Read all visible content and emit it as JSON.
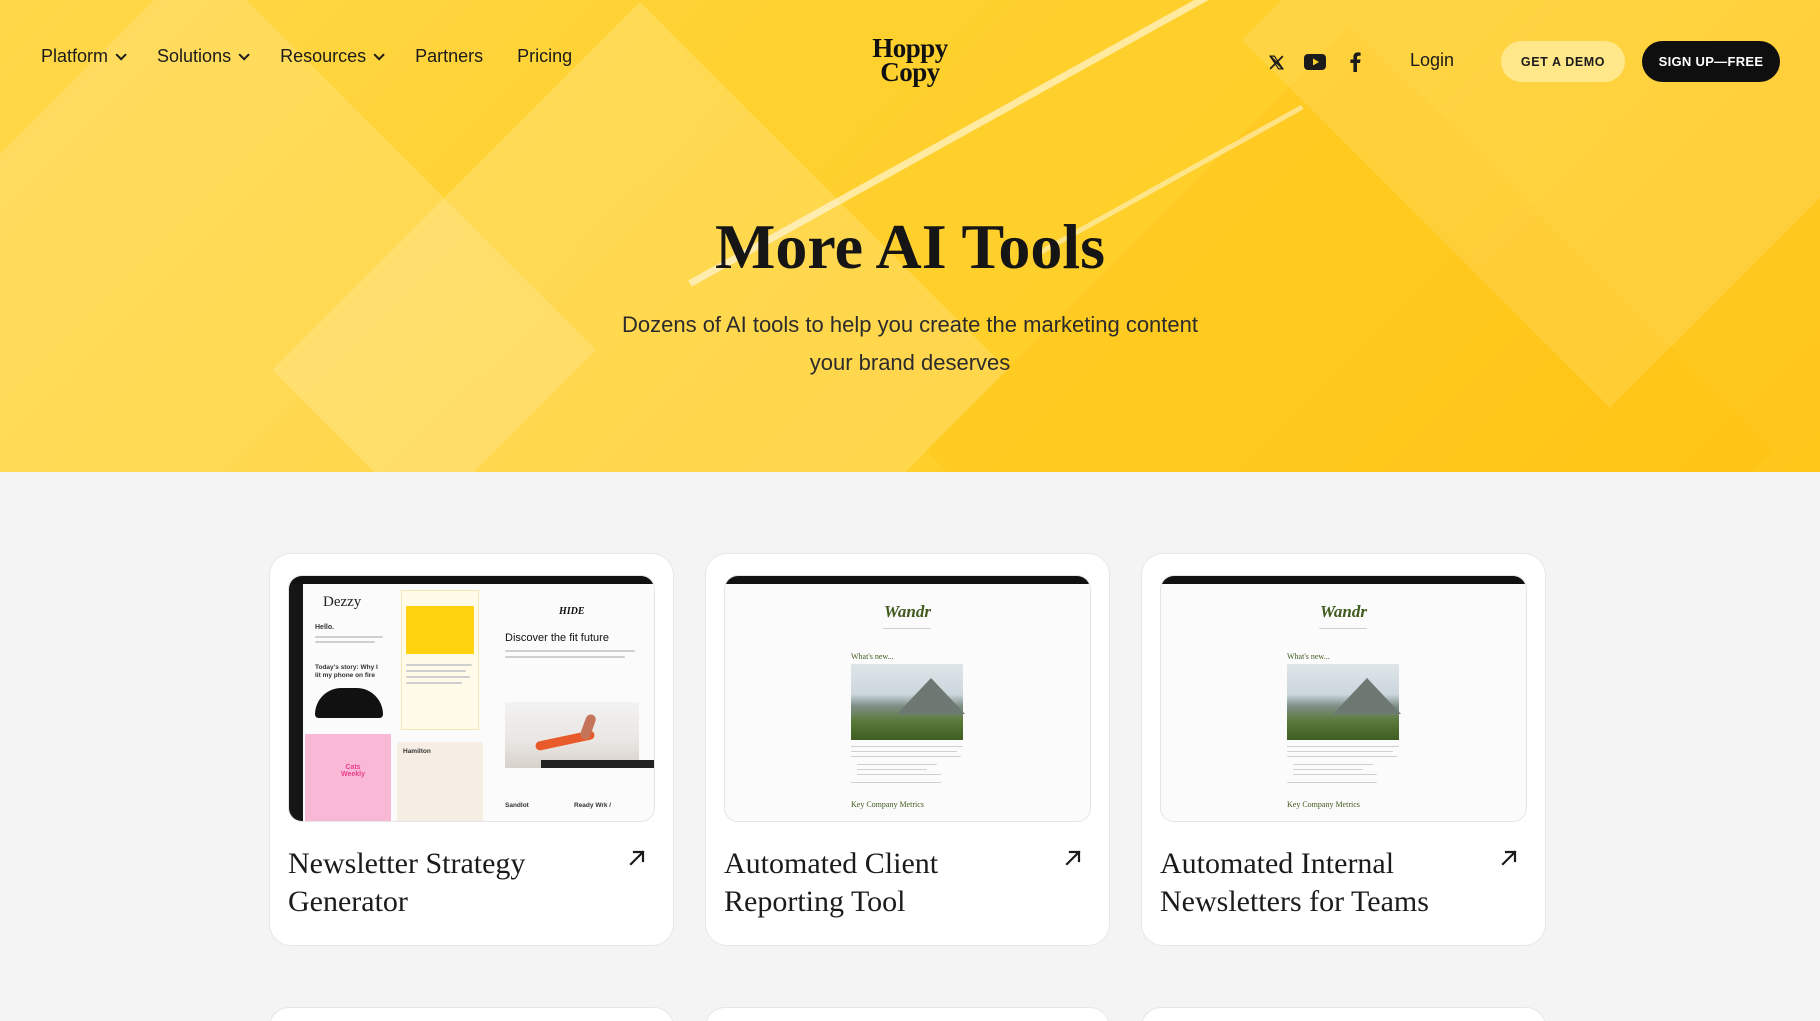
{
  "nav": {
    "items": [
      {
        "label": "Platform",
        "dropdown": true
      },
      {
        "label": "Solutions",
        "dropdown": true
      },
      {
        "label": "Resources",
        "dropdown": true
      },
      {
        "label": "Partners",
        "dropdown": false
      },
      {
        "label": "Pricing",
        "dropdown": false
      }
    ],
    "logo_line1": "Hoppy",
    "logo_line2": "Copy",
    "social": [
      "x-icon",
      "youtube-icon",
      "facebook-icon"
    ],
    "login": "Login",
    "demo_button": "GET A DEMO",
    "signup_button": "SIGN UP—FREE"
  },
  "hero": {
    "title": "More AI Tools",
    "subtitle": "Dozens of AI tools to help you create the marketing content your brand deserves"
  },
  "cards": [
    {
      "title": "Newsletter Strategy Generator",
      "preview": {
        "brand": "Dezzy",
        "greeting": "Hello.",
        "story": "Today's story: Why I lit my phone on fire",
        "brand2": "HIDE",
        "headline": "Discover the fit future",
        "brand3": "Cats Weekly",
        "brand4": "Hamilton",
        "foot1": "Sandlot",
        "foot2": "Ready Wrk /"
      }
    },
    {
      "title": "Automated Client Reporting Tool",
      "preview": {
        "brand": "Wandr",
        "section": "What's new...",
        "metrics": "Key Company Metrics"
      }
    },
    {
      "title": "Automated Internal Newsletters for Teams",
      "preview": {
        "brand": "Wandr",
        "section": "What's new...",
        "metrics": "Key Company Metrics"
      }
    }
  ],
  "colors": {
    "hero_yellow": "#ffd12e",
    "accent_black": "#0f0f0f",
    "demo_button": "#ffe78a",
    "wandr_green": "#3f5a1c"
  }
}
